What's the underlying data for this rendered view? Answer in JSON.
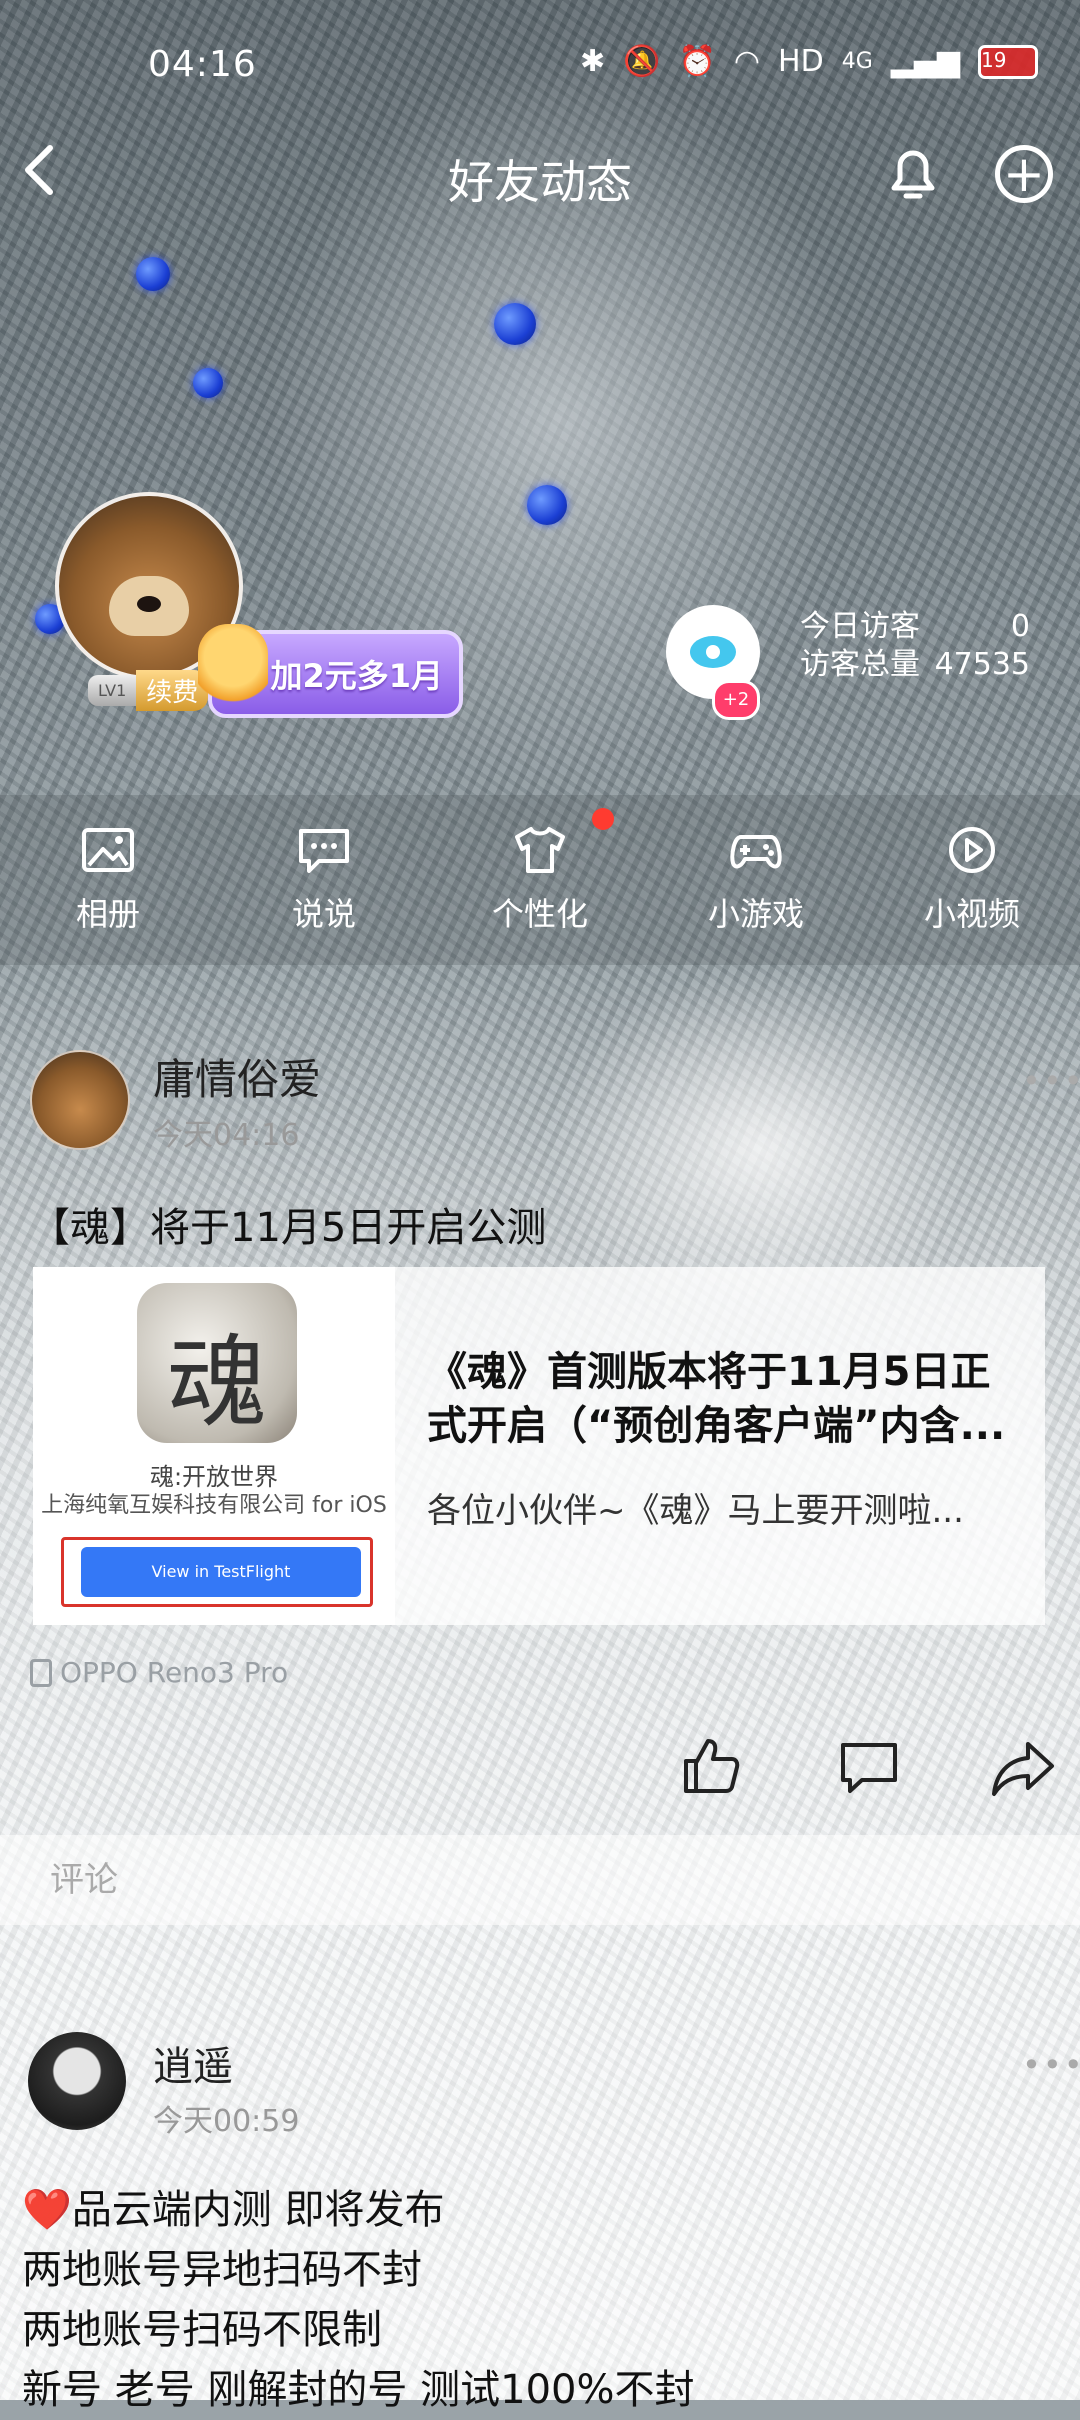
{
  "status_bar": {
    "time": "04:16",
    "network": "HD",
    "signal": "4G",
    "battery": "19"
  },
  "header": {
    "title": "好友动态",
    "back_icon": "chevron-left-icon",
    "bell_icon": "bell-icon",
    "plus_icon": "plus-circle-icon"
  },
  "profile": {
    "level": "LV1",
    "renew_label": "续费",
    "vip_promo": "加2元多1月",
    "visitors_badge": "+2",
    "today_visitors_label": "今日访客",
    "today_visitors_value": "0",
    "total_visitors_label": "访客总量",
    "total_visitors_value": "47535"
  },
  "nav": {
    "items": [
      {
        "label": "相册",
        "icon": "photo-icon"
      },
      {
        "label": "说说",
        "icon": "chat-bubble-icon"
      },
      {
        "label": "个性化",
        "icon": "tshirt-icon"
      },
      {
        "label": "小游戏",
        "icon": "gamepad-icon"
      },
      {
        "label": "小视频",
        "icon": "play-circle-icon"
      }
    ]
  },
  "posts": [
    {
      "author": "庸情俗爱",
      "time": "今天04:16",
      "text": "【魂】将于11月5日开启公测",
      "link": {
        "app_icon_glyph": "魂",
        "app_name": "魂:开放世界",
        "app_dev": "上海纯氧互娱科技有限公司 for iOS",
        "button_label": "View in TestFlight",
        "title": "《魂》首测版本将于11月5日正式开启（“预创角客户端”内含...",
        "desc": "各位小伙伴~《魂》马上要开测啦..."
      },
      "device": "OPPO Reno3 Pro",
      "comment_placeholder": "评论"
    },
    {
      "author": "逍遥",
      "time": "今天00:59",
      "lines": [
        "品云端内测 即将发布",
        "两地账号异地扫码不封",
        "两地账号扫码不限制",
        "新号 老号 刚解封的号   测试100%不封"
      ],
      "heart": "❤️"
    }
  ],
  "colors": {
    "accent_blue": "#3478f6",
    "red_dot": "#ff3b30",
    "vip_purple": "#8a5de8"
  }
}
